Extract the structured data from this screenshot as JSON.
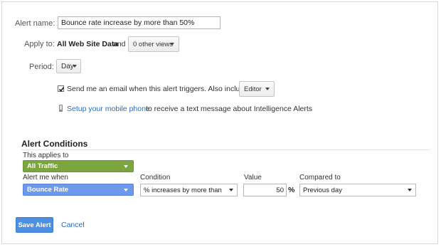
{
  "form": {
    "alert_name_label": "Alert name:",
    "alert_name_value": "Bounce rate increase by more than 50%",
    "apply_to_label": "Apply to:",
    "apply_to_property": "All Web Site Data",
    "apply_to_and": "and",
    "views_dropdown": "0 other views",
    "period_label": "Period:",
    "period_value": "Day",
    "email_checkbox_checked": true,
    "email_text": "Send me an email when this alert triggers. Also include",
    "editor_dropdown": "Editor",
    "mobile_link": "Setup your mobile phone",
    "mobile_text": "to receive a text message about Intelligence Alerts"
  },
  "conditions": {
    "title": "Alert Conditions",
    "applies_to_label": "This applies to",
    "applies_to_value": "All Traffic",
    "alert_me_label": "Alert me when",
    "alert_me_value": "Bounce Rate",
    "condition_label": "Condition",
    "condition_value": "% increases by more than",
    "value_label": "Value",
    "value_input": "50",
    "value_unit": "%",
    "compared_label": "Compared to",
    "compared_value": "Previous day"
  },
  "actions": {
    "save": "Save Alert",
    "cancel": "Cancel"
  },
  "colors": {
    "traffic_green": "#7aa53f",
    "metric_blue": "#6f97ea",
    "primary_blue": "#4d8fe0",
    "link_blue": "#2a6ebb"
  }
}
